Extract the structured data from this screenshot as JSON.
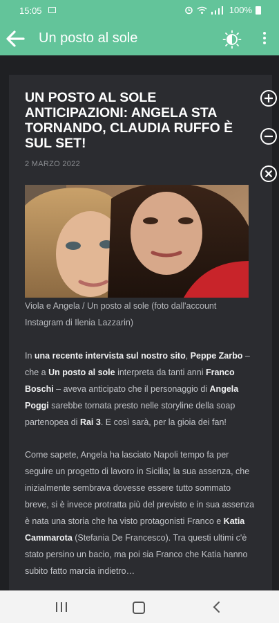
{
  "statusbar": {
    "time": "15:05",
    "battery": "100%"
  },
  "appbar": {
    "title": "Un posto al sole"
  },
  "article": {
    "headline": "UN POSTO AL SOLE ANTICIPAZIONI: ANGELA STA TORNANDO, CLAUDIA RUFFO È SUL SET!",
    "date": "2 MARZO 2022",
    "caption": "Viola e Angela / Un posto al sole (foto dall'account Instagram di Ilenia Lazzarin)",
    "p1": [
      {
        "t": "In ",
        "b": false
      },
      {
        "t": "una recente intervista sul nostro sito",
        "b": true
      },
      {
        "t": ", ",
        "b": false
      },
      {
        "t": "Peppe Zarbo",
        "b": true
      },
      {
        "t": " – che a ",
        "b": false
      },
      {
        "t": "Un posto al sole",
        "b": true
      },
      {
        "t": " interpreta da tanti anni ",
        "b": false
      },
      {
        "t": "Franco Boschi",
        "b": true
      },
      {
        "t": " – aveva anticipato che il personaggio di ",
        "b": false
      },
      {
        "t": "Angela Poggi",
        "b": true
      },
      {
        "t": " sarebbe tornata presto nelle storyline della soap partenopea di ",
        "b": false
      },
      {
        "t": "Rai 3",
        "b": true
      },
      {
        "t": ". E così sarà, per la gioia dei fan!",
        "b": false
      }
    ],
    "p2": [
      {
        "t": "Come sapete, Angela ha lasciato Napoli tempo fa per seguire un progetto di lavoro in Sicilia; la sua assenza, che inizialmente sembrava dovesse essere tutto sommato breve, si è invece protratta più del previsto e in sua assenza è nata una storia che ha visto protagonisti Franco e ",
        "b": false
      },
      {
        "t": "Katia Cammarota",
        "b": true
      },
      {
        "t": " (Stefania De Francesco). Tra questi ultimi c'è stato persino un bacio, ma poi sia Franco che Katia hanno subito fatto marcia indietro…",
        "b": false
      }
    ]
  },
  "icons": {
    "back": "arrow-left-icon",
    "theme": "brightness-icon",
    "more": "more-vert-icon",
    "zoom_in": "zoom-in-icon",
    "zoom_out": "zoom-out-icon",
    "close": "close-icon"
  },
  "colors": {
    "accent": "#63c49a",
    "background": "#1f2023",
    "card": "#2b2c30"
  }
}
